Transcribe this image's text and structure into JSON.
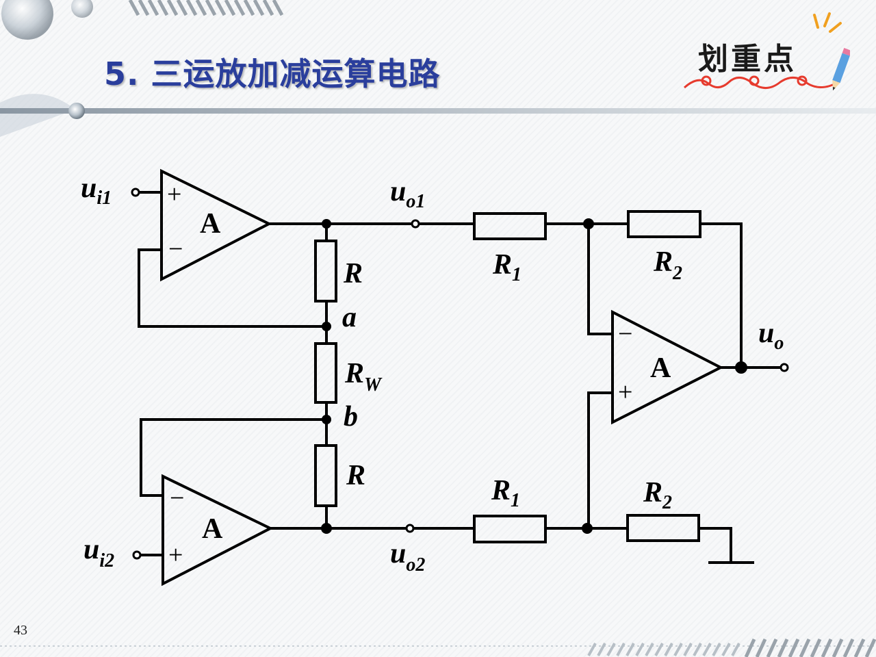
{
  "slide": {
    "title": "5. 三运放加减运算电路",
    "page_number": "43"
  },
  "badge": {
    "text": "划重点",
    "icon": "pencil-icon",
    "accent_color": "#e63b2e"
  },
  "colors": {
    "title": "#2a3e9c",
    "wire": "#000000"
  },
  "circuit": {
    "amplifier_label": "A",
    "plus_sign": "+",
    "minus_sign": "−",
    "input1": {
      "main": "u",
      "sub": "i1"
    },
    "input2": {
      "main": "u",
      "sub": "i2"
    },
    "output1": {
      "main": "u",
      "sub": "o1"
    },
    "output2": {
      "main": "u",
      "sub": "o2"
    },
    "output": {
      "main": "u",
      "sub": "o"
    },
    "resistor_r_top": "R",
    "resistor_r_bottom": "R",
    "resistor_rw": {
      "main": "R",
      "sub": "W"
    },
    "node_a": "a",
    "node_b": "b",
    "r1_top": {
      "main": "R",
      "sub": "1"
    },
    "r1_bottom": {
      "main": "R",
      "sub": "1"
    },
    "r2_top": {
      "main": "R",
      "sub": "2"
    },
    "r2_bottom": {
      "main": "R",
      "sub": "2"
    }
  }
}
